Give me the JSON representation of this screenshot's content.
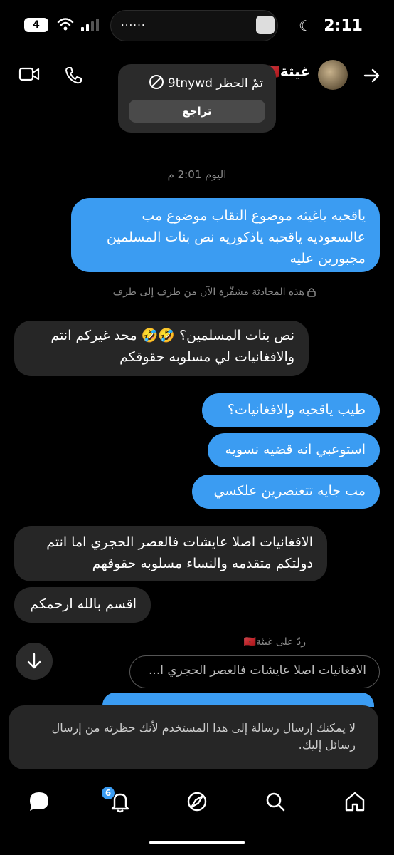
{
  "status": {
    "time": "2:11",
    "battery": "4",
    "island_text": "......"
  },
  "header": {
    "name": "غيثة",
    "flag": "🇲🇦"
  },
  "toast": {
    "title": "تمّ الحظر 9tnywd",
    "button": "تراجع"
  },
  "date_label": "اليوم 2:01 م",
  "encryption_note": "هذه المحادثة مشفّرة الآن من طرف إلى طرف",
  "messages": [
    {
      "dir": "out",
      "text": "ياقحبه ياغيثه موضوع النقاب موضوع مب عالسعوديه ياقحبه ياذكوريه نص بنات المسلمين مجبورين عليه"
    },
    {
      "dir": "in",
      "text": "نص بنات المسلمين؟ 🤣🤣 محد غيركم انتم والافغانيات لي مسلوبه حقوقكم"
    },
    {
      "dir": "out",
      "text": "طيب ياقحبه والافغانيات؟"
    },
    {
      "dir": "out",
      "text": "استوعبي انه قضيه نسويه"
    },
    {
      "dir": "out",
      "text": "مب جايه تتعنصرين علكسي"
    },
    {
      "dir": "in",
      "text": "الافغانيات اصلا عايشات فالعصر الحجري اما انتم دولتكم متقدمه والنساء مسلوبه حقوقهم"
    },
    {
      "dir": "in",
      "text": "اقسم بالله ارحمكم"
    }
  ],
  "reply": {
    "label": "ردّ على غيثة🇲🇦",
    "quote": "الافغانيات اصلا عايشات فالعصر الحجري ا..."
  },
  "blocked_notice": "لا يمكنك إرسال رسالة إلى هذا المستخدم لأنك حظرته من إرسال رسائل إليك.",
  "nav": {
    "notification_badge": "6"
  },
  "colors": {
    "accent": "#3b9cf2",
    "incoming": "#262626",
    "background": "#000000"
  }
}
